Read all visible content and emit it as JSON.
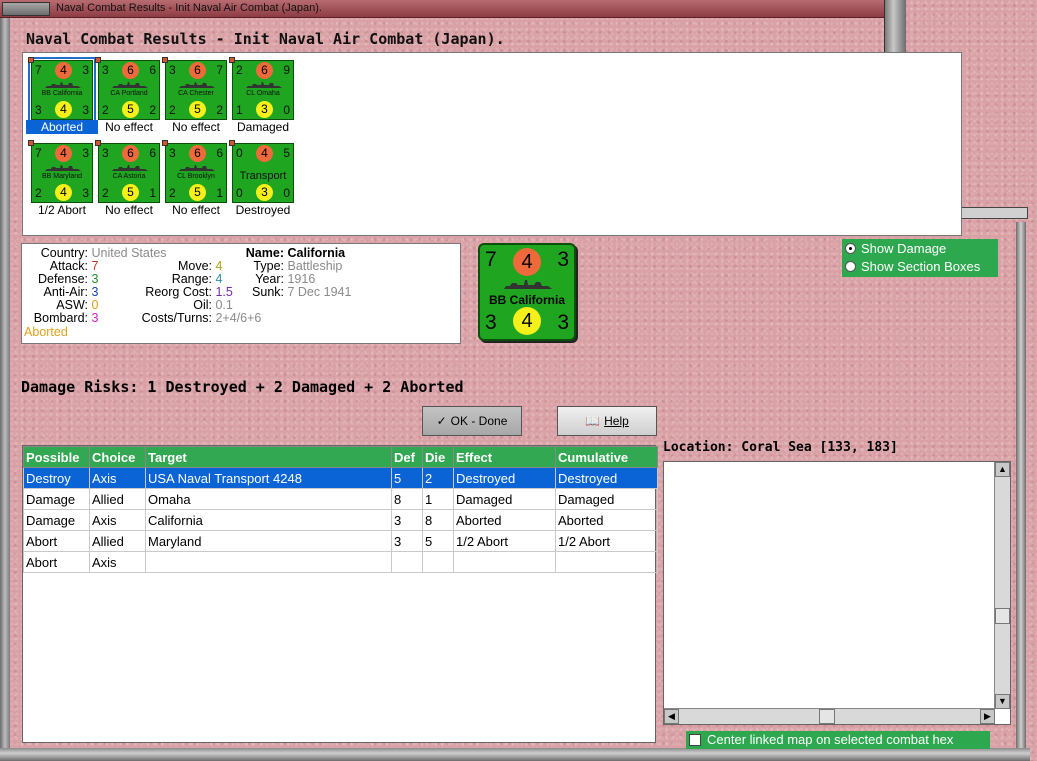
{
  "window": {
    "title": "Naval Combat Results - Init Naval Air Combat (Japan)."
  },
  "heading": "Naval Combat Results - Init Naval Air Combat (Japan).",
  "counters": [
    {
      "name": "BB California",
      "tl": "7",
      "top": "4",
      "tr": "3",
      "bl": "3",
      "bottom": "4",
      "br": "3",
      "label": "Aborted",
      "selected": true
    },
    {
      "name": "CA Portland",
      "tl": "3",
      "top": "6",
      "tr": "6",
      "bl": "2",
      "bottom": "5",
      "br": "2",
      "label": "No effect"
    },
    {
      "name": "CA Chester",
      "tl": "3",
      "top": "6",
      "tr": "7",
      "bl": "2",
      "bottom": "5",
      "br": "2",
      "label": "No effect"
    },
    {
      "name": "CL Omaha",
      "tl": "2",
      "top": "6",
      "tr": "9",
      "bl": "1",
      "bottom": "3",
      "br": "0",
      "label": "Damaged"
    },
    {
      "name": "BB Maryland",
      "tl": "7",
      "top": "4",
      "tr": "3",
      "bl": "2",
      "bottom": "4",
      "br": "3",
      "label": "1/2 Abort"
    },
    {
      "name": "CA Astoria",
      "tl": "3",
      "top": "6",
      "tr": "6",
      "bl": "2",
      "bottom": "5",
      "br": "1",
      "label": "No effect"
    },
    {
      "name": "CL Brooklyn",
      "tl": "3",
      "top": "6",
      "tr": "6",
      "bl": "2",
      "bottom": "5",
      "br": "1",
      "label": "No effect"
    },
    {
      "name": "Transport",
      "tl": "0",
      "top": "4",
      "tr": "5",
      "bl": "0",
      "bottom": "3",
      "br": "0",
      "label": "Destroyed"
    }
  ],
  "info": {
    "country_label": "Country:",
    "country": "United States",
    "attack_label": "Attack:",
    "attack": "7",
    "defense_label": "Defense:",
    "defense": "3",
    "antiair_label": "Anti-Air:",
    "antiair": "3",
    "asw_label": "ASW:",
    "asw": "0",
    "bombard_label": "Bombard:",
    "bombard": "3",
    "status": "Aborted",
    "move_label": "Move:",
    "move": "4",
    "range_label": "Range:",
    "range": "4",
    "reorg_label": "Reorg Cost:",
    "reorg": "1.5",
    "oil_label": "Oil:",
    "oil": "0.1",
    "costs_label": "Costs/Turns:",
    "costs": "2+4/6+6",
    "name_label": "Name:",
    "name": "California",
    "type_label": "Type:",
    "type": "Battleship",
    "year_label": "Year:",
    "year": "1916",
    "sunk_label": "Sunk:",
    "sunk": "7 Dec 1941"
  },
  "big_counter": {
    "name": "BB California",
    "tl": "7",
    "top": "4",
    "tr": "3",
    "bl": "3",
    "bottom": "4",
    "br": "3"
  },
  "options": {
    "show_damage": "Show Damage",
    "show_section_boxes": "Show Section Boxes"
  },
  "damage_risks": "Damage Risks:  1 Destroyed + 2 Damaged + 2 Aborted",
  "buttons": {
    "ok": "OK - Done",
    "help": "Help"
  },
  "table": {
    "headers": [
      "Possible",
      "Choice",
      "Target",
      "Def",
      "Die",
      "Effect",
      "Cumulative"
    ],
    "rows": [
      [
        "Destroy",
        "Axis",
        "USA Naval Transport 4248",
        "5",
        "2",
        "Destroyed",
        "Destroyed"
      ],
      [
        "Damage",
        "Allied",
        "Omaha",
        "8",
        "1",
        "Damaged",
        "Damaged"
      ],
      [
        "Damage",
        "Axis",
        "California",
        "3",
        "8",
        "Aborted",
        "Aborted"
      ],
      [
        "Abort",
        "Allied",
        "Maryland",
        "3",
        "5",
        "1/2 Abort",
        "1/2 Abort"
      ],
      [
        "Abort",
        "Axis",
        "",
        "",
        "",
        "",
        ""
      ]
    ]
  },
  "location": "Location:  Coral Sea [133, 183]",
  "center_linked": "Center linked map on selected combat hex",
  "colors": {
    "attack": "#c0392b",
    "defense": "#1f8f2f",
    "antiair": "#1a3fb0",
    "asw": "#e79a1a",
    "bombard": "#c81fc8",
    "status": "#e0a21a",
    "move": "#b1a50f",
    "range": "#2a8fa8",
    "reorg": "#7a2aa8",
    "grey": "#8a8a8a"
  }
}
